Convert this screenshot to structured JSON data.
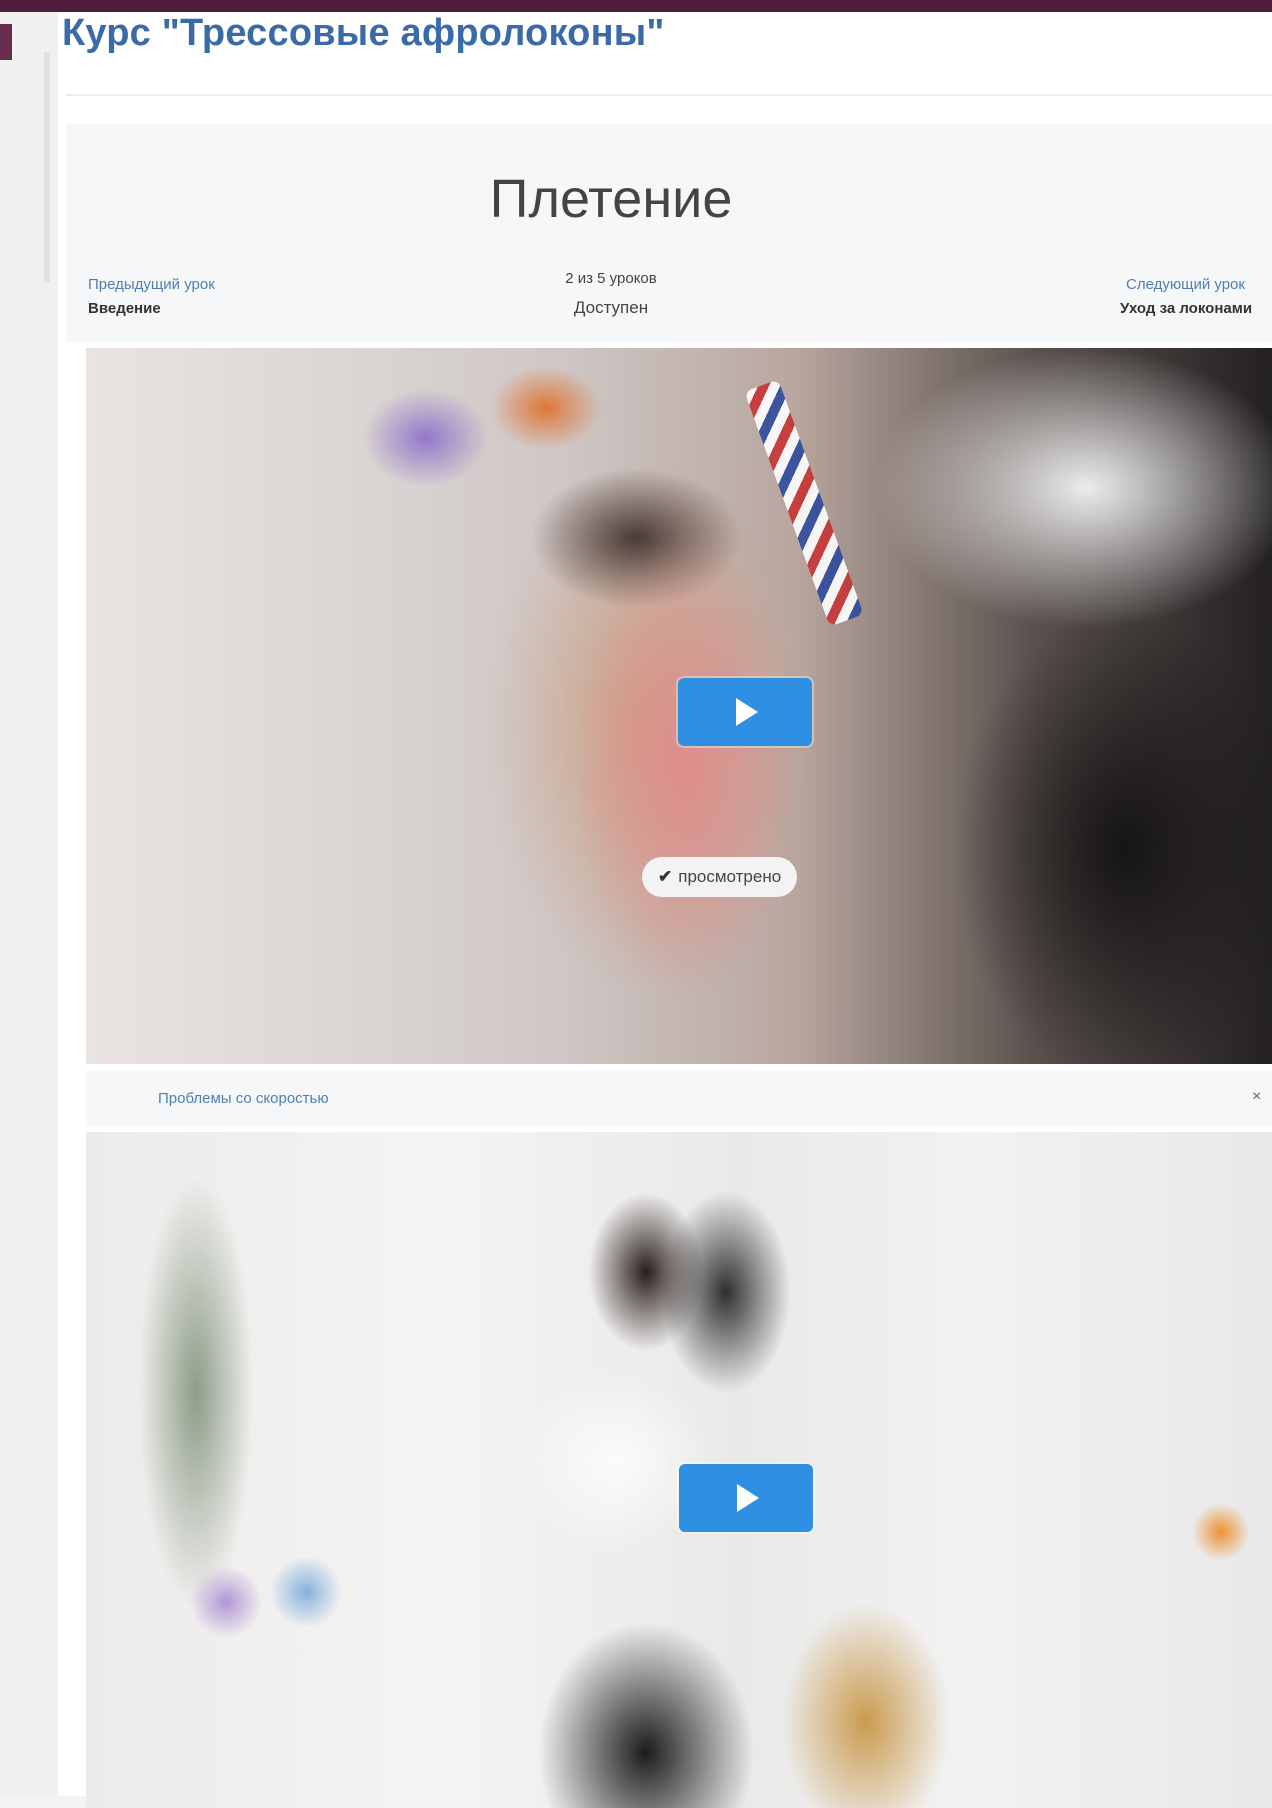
{
  "course": {
    "title": "Курс \"Трессовые афролоконы\""
  },
  "lesson": {
    "title": "Плетение",
    "prev_label": "Предыдущий урок",
    "prev_name": "Введение",
    "count": "2 из 5 уроков",
    "status": "Доступен",
    "next_label": "Следующий урок",
    "next_name": "Уход за локонами"
  },
  "video1": {
    "play_icon": "play-icon",
    "watched_label": "просмотрено",
    "watched_icon": "check-icon"
  },
  "speed_bar": {
    "link": "Проблемы со скоростью",
    "close": "×"
  },
  "video2": {
    "play_icon": "play-icon"
  },
  "colors": {
    "topbar": "#4e1d3b",
    "title_blue": "#3a6ba8",
    "link_blue": "#4f7fb2",
    "play_button": "#2f8fe2"
  }
}
